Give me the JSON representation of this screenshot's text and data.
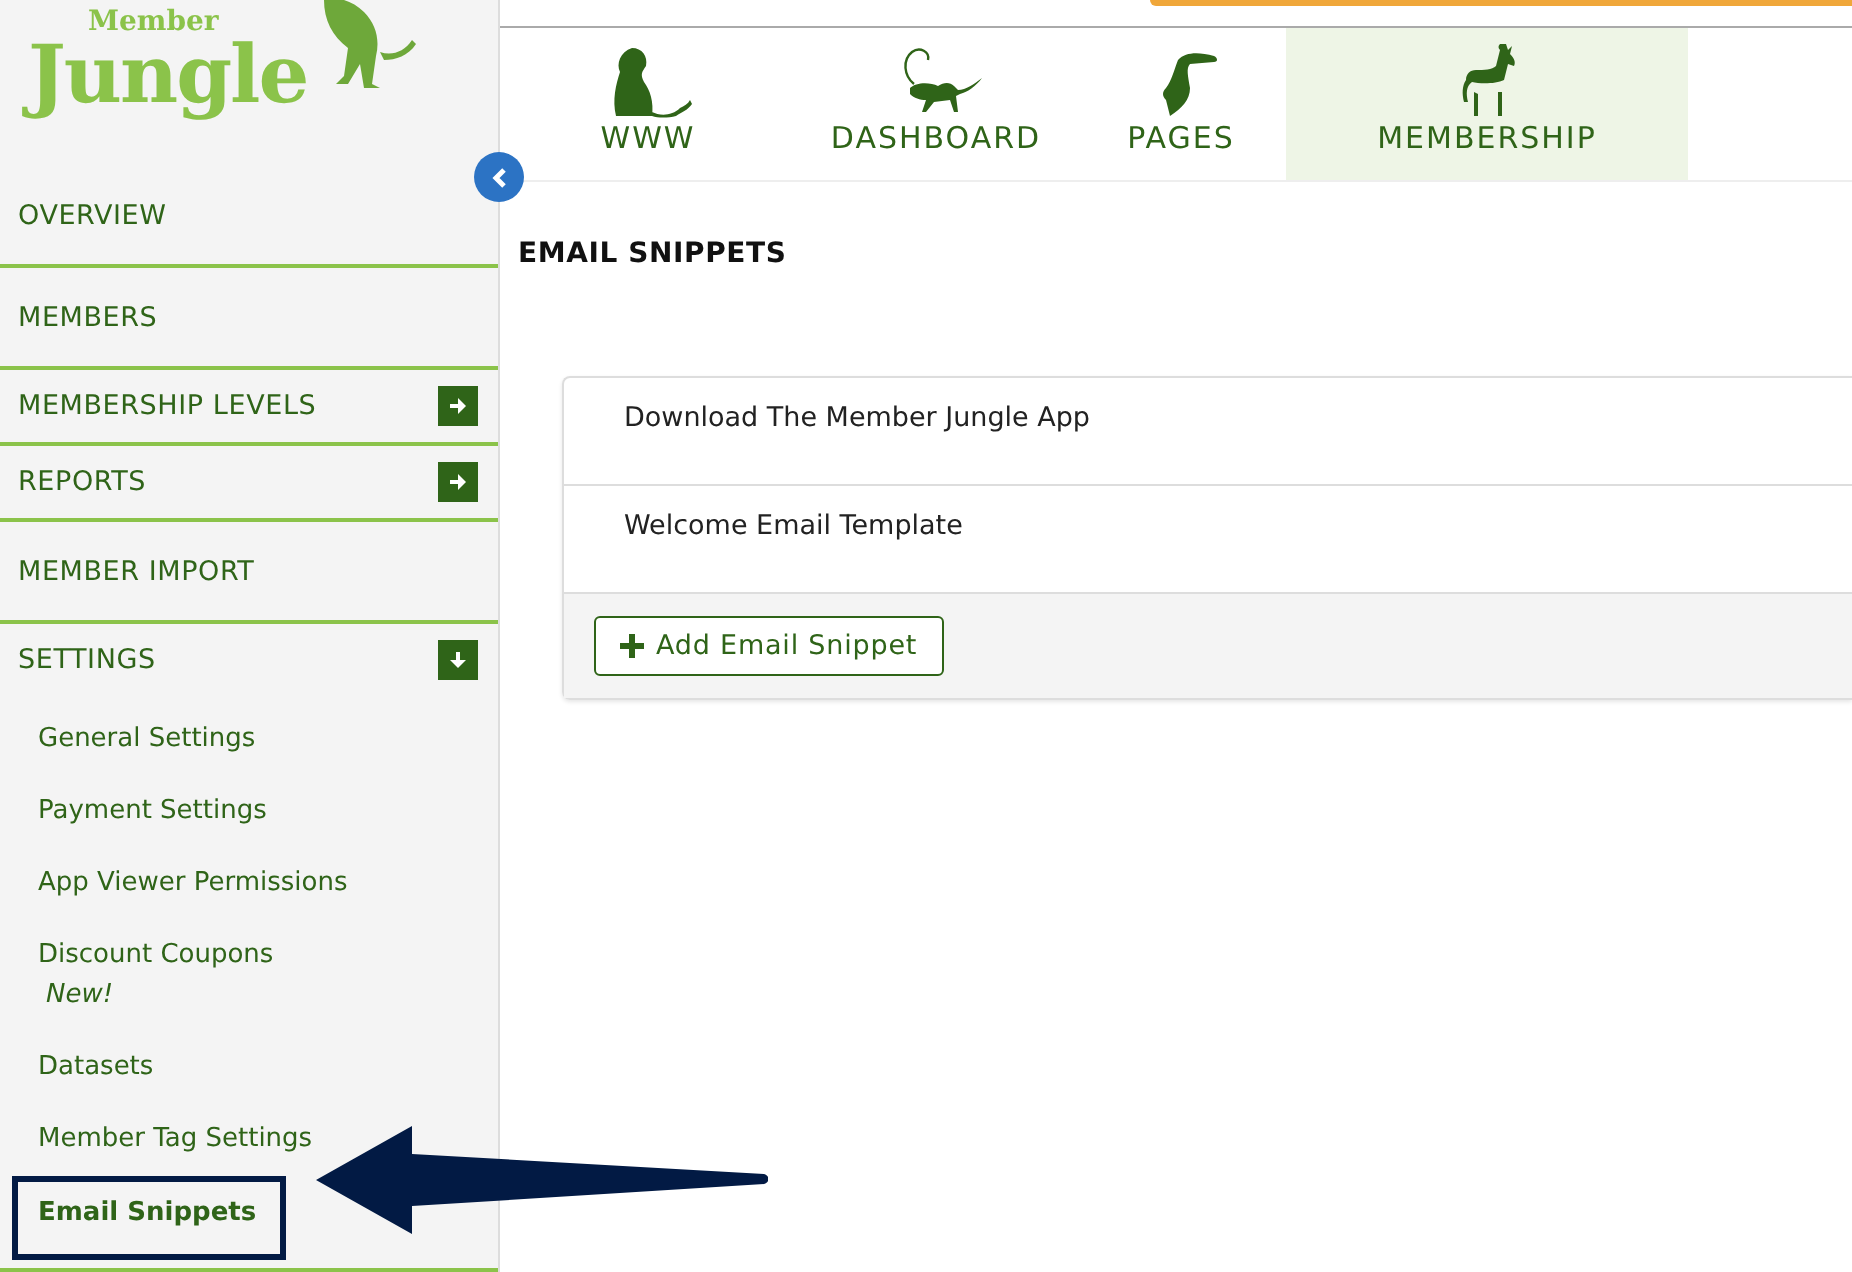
{
  "logo": {
    "line_1": "Member",
    "line_2": "Jungle"
  },
  "nav_tabs": [
    {
      "label": "WWW",
      "selected": false
    },
    {
      "label": "DASHBOARD",
      "selected": false
    },
    {
      "label": "PAGES",
      "selected": false
    },
    {
      "label": "MEMBERSHIP",
      "selected": true
    }
  ],
  "sidebar": {
    "items": [
      {
        "label": "OVERVIEW",
        "kind": "plain"
      },
      {
        "label": "MEMBERS",
        "kind": "plain"
      },
      {
        "label": "MEMBERSHIP LEVELS",
        "kind": "expandable",
        "expanded": false
      },
      {
        "label": "REPORTS",
        "kind": "expandable",
        "expanded": false
      },
      {
        "label": "MEMBER IMPORT",
        "kind": "plain"
      },
      {
        "label": "SETTINGS",
        "kind": "expandable",
        "expanded": true,
        "children": [
          {
            "label": "General Settings",
            "selected": false
          },
          {
            "label": "Payment Settings",
            "selected": false
          },
          {
            "label": "App Viewer Permissions",
            "selected": false
          },
          {
            "label": "Discount Coupons",
            "badge": "New!",
            "selected": false
          },
          {
            "label": "Datasets",
            "selected": false
          },
          {
            "label": "Member Tag Settings",
            "selected": false
          },
          {
            "label": "Email Snippets",
            "selected": true
          }
        ]
      }
    ]
  },
  "page_title": "EMAIL SNIPPETS",
  "snippets": [
    "Download The Member Jungle App",
    "Welcome Email Template"
  ],
  "add_button": {
    "label": "Add Email Snippet"
  }
}
